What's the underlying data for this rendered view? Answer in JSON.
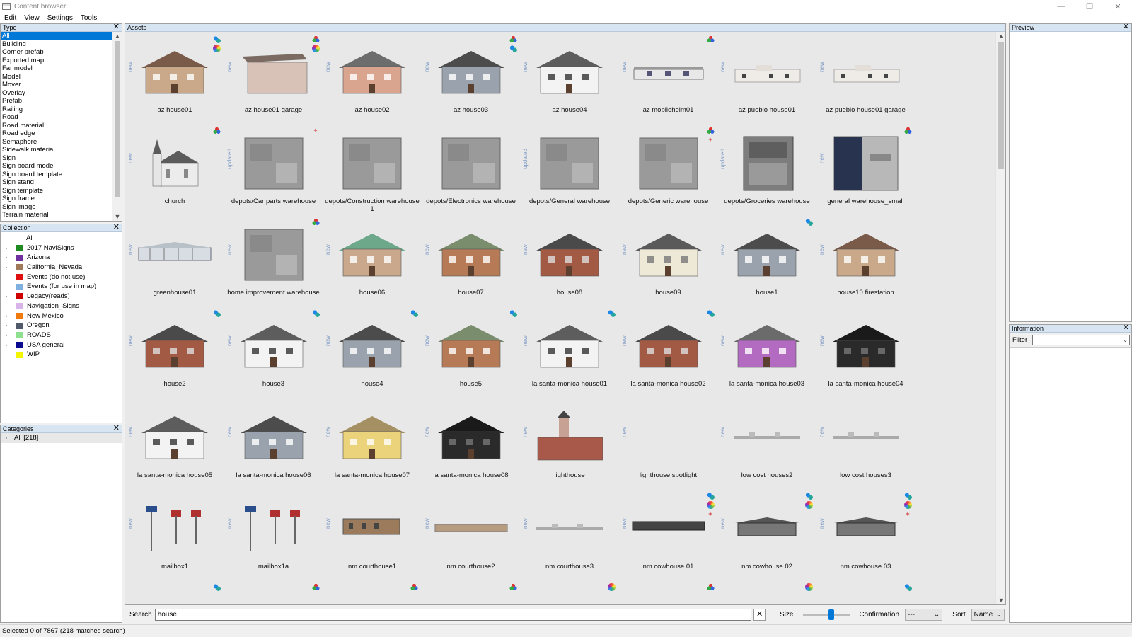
{
  "window": {
    "title": "Content browser",
    "controls": [
      "—",
      "❐",
      "✕"
    ]
  },
  "menu": [
    "Edit",
    "View",
    "Settings",
    "Tools"
  ],
  "type_panel": {
    "title": "Type",
    "items": [
      "All",
      "Building",
      "Corner prefab",
      "Exported map",
      "Far model",
      "Model",
      "Mover",
      "Overlay",
      "Prefab",
      "Railing",
      "Road",
      "Road material",
      "Road edge",
      "Semaphore",
      "Sidewalk material",
      "Sign",
      "Sign board model",
      "Sign board template",
      "Sign stand",
      "Sign template",
      "Sign frame",
      "Sign image",
      "Terrain material"
    ],
    "selected": "All"
  },
  "collection_panel": {
    "title": "Collection",
    "all_label": "All",
    "items": [
      {
        "name": "2017 NaviSigns",
        "color": "#1f8a1f",
        "expandable": true
      },
      {
        "name": "Arizona",
        "color": "#7030a0",
        "expandable": true
      },
      {
        "name": "California_Nevada",
        "color": "#a0785a",
        "expandable": true
      },
      {
        "name": "Events (do not use)",
        "color": "#e01010",
        "expandable": false
      },
      {
        "name": "Events (for use in map)",
        "color": "#7fb0e0",
        "expandable": false
      },
      {
        "name": "Legacy(reads)",
        "color": "#d00000",
        "expandable": true
      },
      {
        "name": "Navigation_Signs",
        "color": "#d8b4e8",
        "expandable": false
      },
      {
        "name": "New Mexico",
        "color": "#f07a10",
        "expandable": true
      },
      {
        "name": "Oregon",
        "color": "#505a6a",
        "expandable": true
      },
      {
        "name": "ROADS",
        "color": "#8ee08e",
        "expandable": true
      },
      {
        "name": "USA general",
        "color": "#0a0a90",
        "expandable": true
      },
      {
        "name": "WIP",
        "color": "#f5f500",
        "expandable": false
      }
    ]
  },
  "categories_panel": {
    "title": "Categories",
    "item": "All [218]"
  },
  "assets_panel": {
    "title": "Assets",
    "items": [
      {
        "label": "az house01",
        "tag": "new",
        "badges": [
          "bi",
          "wheel"
        ],
        "thumb": "house-tan"
      },
      {
        "label": "az house01 garage",
        "tag": "new",
        "badges": [
          "rgb",
          "wheel"
        ],
        "thumb": "box-tan"
      },
      {
        "label": "az house02",
        "tag": "new",
        "badges": [],
        "thumb": "house-pink"
      },
      {
        "label": "az house03",
        "tag": "new",
        "badges": [
          "rgb",
          "bi"
        ],
        "thumb": "house-grey"
      },
      {
        "label": "az house04",
        "tag": "new",
        "badges": [],
        "thumb": "house-white"
      },
      {
        "label": "az mobileheim01",
        "tag": "new",
        "badges": [
          "rgb"
        ],
        "thumb": "mobile"
      },
      {
        "label": "az pueblo house01",
        "tag": "new",
        "badges": [],
        "thumb": "pueblo"
      },
      {
        "label": "az pueblo house01 garage",
        "tag": "new",
        "badges": [],
        "thumb": "pueblo"
      },
      {
        "label": "church",
        "tag": "new",
        "badges": [
          "rgb"
        ],
        "thumb": "church"
      },
      {
        "label": "depots/Car parts warehouse",
        "tag": "updated",
        "badges": [
          "plus"
        ],
        "thumb": "top-grey"
      },
      {
        "label": "depots/Construction warehouse 1",
        "tag": "",
        "badges": [],
        "thumb": "top-grey"
      },
      {
        "label": "depots/Electronics warehouse",
        "tag": "",
        "badges": [],
        "thumb": "top-grey"
      },
      {
        "label": "depots/General warehouse",
        "tag": "updated",
        "badges": [],
        "thumb": "top-grey"
      },
      {
        "label": "depots/Generic warehouse",
        "tag": "",
        "badges": [
          "rgb",
          "plus"
        ],
        "thumb": "top-grey"
      },
      {
        "label": "depots/Groceries warehouse",
        "tag": "updated",
        "badges": [],
        "thumb": "top-dark"
      },
      {
        "label": "general warehouse_small",
        "tag": "new",
        "badges": [
          "rgb"
        ],
        "thumb": "solar"
      },
      {
        "label": "greenhouse01",
        "tag": "new",
        "badges": [],
        "thumb": "greenhouse"
      },
      {
        "label": "home improvement warehouse",
        "tag": "new",
        "badges": [
          "rgb"
        ],
        "thumb": "top-grey"
      },
      {
        "label": "house06",
        "tag": "new",
        "badges": [],
        "thumb": "house-green"
      },
      {
        "label": "house07",
        "tag": "new",
        "badges": [],
        "thumb": "house-brown"
      },
      {
        "label": "house08",
        "tag": "new",
        "badges": [],
        "thumb": "house-brick"
      },
      {
        "label": "house09",
        "tag": "new",
        "badges": [],
        "thumb": "house-cream"
      },
      {
        "label": "house1",
        "tag": "new",
        "badges": [
          "bi"
        ],
        "thumb": "house-grey"
      },
      {
        "label": "house10 firestation",
        "tag": "new",
        "badges": [],
        "thumb": "house-tan"
      },
      {
        "label": "house2",
        "tag": "new",
        "badges": [
          "bi"
        ],
        "thumb": "house-brick"
      },
      {
        "label": "house3",
        "tag": "new",
        "badges": [
          "bi"
        ],
        "thumb": "house-white"
      },
      {
        "label": "house4",
        "tag": "new",
        "badges": [
          "bi"
        ],
        "thumb": "house-grey"
      },
      {
        "label": "house5",
        "tag": "new",
        "badges": [
          "bi"
        ],
        "thumb": "house-brown"
      },
      {
        "label": "la santa-monica house01",
        "tag": "new",
        "badges": [
          "bi"
        ],
        "thumb": "house-white"
      },
      {
        "label": "la santa-monica house02",
        "tag": "new",
        "badges": [
          "bi"
        ],
        "thumb": "house-brick"
      },
      {
        "label": "la santa-monica house03",
        "tag": "new",
        "badges": [],
        "thumb": "house-purple"
      },
      {
        "label": "la santa-monica house04",
        "tag": "new",
        "badges": [],
        "thumb": "house-black"
      },
      {
        "label": "la santa-monica house05",
        "tag": "new",
        "badges": [],
        "thumb": "house-white"
      },
      {
        "label": "la santa-monica house06",
        "tag": "new",
        "badges": [],
        "thumb": "house-grey"
      },
      {
        "label": "la santa-monica house07",
        "tag": "new",
        "badges": [],
        "thumb": "house-yellow"
      },
      {
        "label": "la santa-monica house08",
        "tag": "new",
        "badges": [],
        "thumb": "house-black"
      },
      {
        "label": "lighthouse",
        "tag": "new",
        "badges": [],
        "thumb": "lighthouse"
      },
      {
        "label": "lighthouse spotlight",
        "tag": "new",
        "badges": [],
        "thumb": "empty"
      },
      {
        "label": "low cost houses2",
        "tag": "new",
        "badges": [],
        "thumb": "flat"
      },
      {
        "label": "low cost houses3",
        "tag": "new",
        "badges": [],
        "thumb": "flat"
      },
      {
        "label": "mailbox1",
        "tag": "new",
        "badges": [],
        "thumb": "mailbox"
      },
      {
        "label": "mailbox1a",
        "tag": "new",
        "badges": [],
        "thumb": "mailbox"
      },
      {
        "label": "nm courthouse1",
        "tag": "new",
        "badges": [],
        "thumb": "long-brown"
      },
      {
        "label": "nm courthouse2",
        "tag": "new",
        "badges": [],
        "thumb": "long-flat"
      },
      {
        "label": "nm courthouse3",
        "tag": "new",
        "badges": [],
        "thumb": "flat"
      },
      {
        "label": "nm cowhouse 01",
        "tag": "new",
        "badges": [
          "bi",
          "wheel",
          "plus"
        ],
        "thumb": "long-dark"
      },
      {
        "label": "nm cowhouse 02",
        "tag": "new",
        "badges": [
          "bi",
          "wheel"
        ],
        "thumb": "shed"
      },
      {
        "label": "nm cowhouse 03",
        "tag": "new",
        "badges": [
          "bi",
          "wheel",
          "plus"
        ],
        "thumb": "shed"
      }
    ]
  },
  "preview_panel": {
    "title": "Preview"
  },
  "information_panel": {
    "title": "Information",
    "filter_label": "Filter"
  },
  "bottom": {
    "search_label": "Search",
    "search_value": "house",
    "size_label": "Size",
    "size_level": 0.6,
    "confirmation_label": "Confirmation",
    "confirmation_value": "---",
    "sort_label": "Sort",
    "sort_value": "Name"
  },
  "status": "Selected 0 of 7867 (218 matches search)"
}
